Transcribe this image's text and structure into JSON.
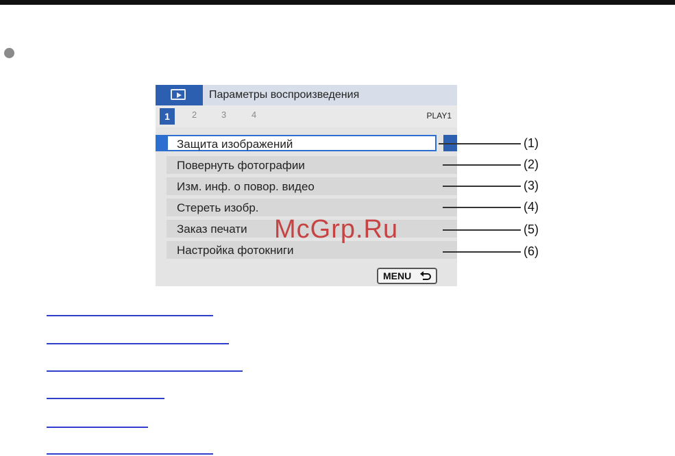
{
  "camera_menu": {
    "header_title": "Параметры воспроизведения",
    "icon": "playback-icon",
    "tabs": [
      "1",
      "2",
      "3",
      "4"
    ],
    "active_tab": "1",
    "tab_label": "PLAY1",
    "items": [
      "Защита изображений",
      "Повернуть фотографии",
      "Изм. инф. о повор. видео",
      "Стереть изобр.",
      "Заказ печати",
      "Настройка фотокниги"
    ],
    "menu_button": "MENU"
  },
  "callouts": [
    "(1)",
    "(2)",
    "(3)",
    "(4)",
    "(5)",
    "(6)"
  ],
  "watermark": "McGrp.Ru",
  "colors": {
    "accent_blue": "#2c5fb0",
    "selection_border": "#2c6fd1",
    "link_color": "#2f3fcb",
    "watermark_color": "#c42a2a"
  }
}
